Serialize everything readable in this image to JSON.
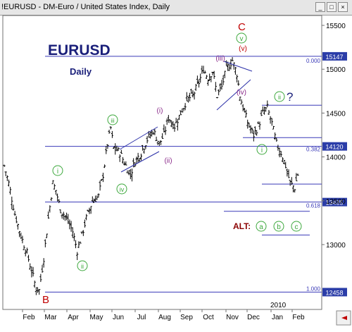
{
  "window": {
    "title": "!EURUSD - DM-Euro / United States Index, Daily",
    "buttons": [
      "_",
      "□",
      "×"
    ]
  },
  "chart_data": {
    "type": "candlestick",
    "title": "EURUSD",
    "subtitle": "Daily",
    "ylim": [
      12300,
      15700
    ],
    "y_ticks": [
      13000,
      13500,
      14000,
      14500,
      15000,
      15500
    ],
    "x_labels": [
      "Feb",
      "Mar",
      "Apr",
      "May",
      "Jun",
      "Jul",
      "Aug",
      "Sep",
      "Oct",
      "Nov",
      "Dec",
      "Jan",
      "Feb"
    ],
    "year_label": "2010",
    "price_boxes": [
      15147,
      14120,
      13485,
      12458
    ],
    "levels": [
      {
        "price": 15147,
        "label": "15147",
        "fib": "0.000",
        "style": "solid"
      },
      {
        "price": 14120,
        "label": "14120",
        "fib": "0.382",
        "style": "solid"
      },
      {
        "price": 13485,
        "label": "13485",
        "fib": "0.618",
        "style": "solid"
      },
      {
        "price": 12458,
        "label": "12458",
        "fib": "1.000",
        "style": "solid"
      }
    ],
    "short_lines": [
      14590,
      14220,
      13690,
      13380,
      13110
    ],
    "waves": {
      "B": "B",
      "C": "C",
      "i": "i",
      "ii": "ii",
      "iii": "iii",
      "iv": "iv",
      "v": "v",
      "sub_i": "(i)",
      "sub_ii": "(ii)",
      "sub_iii": "(iii)",
      "sub_iv": "(iv)",
      "sub_v": "(v)",
      "post_i": "i",
      "post_ii": "ii",
      "question": "?",
      "alt": "ALT:",
      "alt_a": "a",
      "alt_b": "b",
      "alt_c": "c"
    },
    "price_anchors": [
      [
        0,
        13900
      ],
      [
        3,
        13700
      ],
      [
        7,
        13350
      ],
      [
        11,
        13100
      ],
      [
        15,
        12900
      ],
      [
        18,
        12700
      ],
      [
        21,
        12500
      ],
      [
        23,
        12480
      ],
      [
        26,
        12850
      ],
      [
        29,
        13300
      ],
      [
        32,
        13700
      ],
      [
        34,
        13620
      ],
      [
        37,
        13400
      ],
      [
        41,
        13300
      ],
      [
        45,
        13150
      ],
      [
        48,
        12930
      ],
      [
        51,
        13100
      ],
      [
        54,
        13300
      ],
      [
        58,
        13500
      ],
      [
        62,
        13550
      ],
      [
        65,
        13800
      ],
      [
        68,
        14150
      ],
      [
        70,
        14330
      ],
      [
        72,
        14100
      ],
      [
        76,
        14050
      ],
      [
        80,
        13900
      ],
      [
        83,
        13800
      ],
      [
        86,
        13950
      ],
      [
        90,
        14050
      ],
      [
        94,
        14200
      ],
      [
        98,
        14300
      ],
      [
        102,
        14150
      ],
      [
        105,
        14250
      ],
      [
        108,
        14450
      ],
      [
        112,
        14350
      ],
      [
        116,
        14500
      ],
      [
        120,
        14650
      ],
      [
        124,
        14700
      ],
      [
        128,
        14850
      ],
      [
        131,
        15000
      ],
      [
        134,
        14900
      ],
      [
        137,
        14980
      ],
      [
        140,
        14700
      ],
      [
        143,
        14800
      ],
      [
        146,
        15000
      ],
      [
        150,
        15100
      ],
      [
        153,
        14950
      ],
      [
        155,
        14700
      ],
      [
        158,
        14500
      ],
      [
        161,
        14350
      ],
      [
        164,
        14250
      ],
      [
        167,
        14350
      ],
      [
        170,
        14500
      ],
      [
        173,
        14560
      ],
      [
        176,
        14380
      ],
      [
        179,
        14150
      ],
      [
        182,
        14050
      ],
      [
        185,
        13900
      ],
      [
        188,
        13700
      ],
      [
        191,
        13650
      ],
      [
        193,
        13800
      ]
    ]
  }
}
